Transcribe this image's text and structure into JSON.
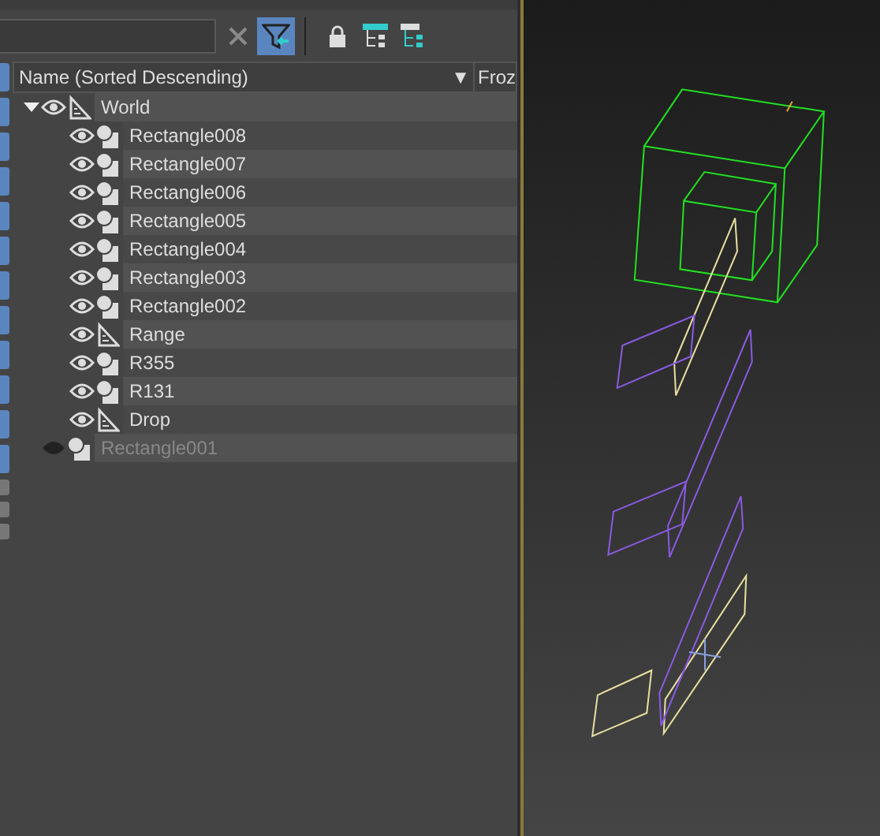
{
  "columns": [
    {
      "label": "Name (Sorted Descending)",
      "sort_icon": "▼"
    },
    {
      "label": "Froz"
    }
  ],
  "tree": [
    {
      "name": "World",
      "kind": "helper",
      "visible": true,
      "expanded": true,
      "children": [
        {
          "name": "Rectangle008",
          "kind": "shape",
          "visible": true
        },
        {
          "name": "Rectangle007",
          "kind": "shape",
          "visible": true
        },
        {
          "name": "Rectangle006",
          "kind": "shape",
          "visible": true
        },
        {
          "name": "Rectangle005",
          "kind": "shape",
          "visible": true
        },
        {
          "name": "Rectangle004",
          "kind": "shape",
          "visible": true
        },
        {
          "name": "Rectangle003",
          "kind": "shape",
          "visible": true
        },
        {
          "name": "Rectangle002",
          "kind": "shape",
          "visible": true
        },
        {
          "name": "Range",
          "kind": "helper",
          "visible": true
        },
        {
          "name": "R355",
          "kind": "shape",
          "visible": true
        },
        {
          "name": "R131",
          "kind": "shape",
          "visible": true
        },
        {
          "name": "Drop",
          "kind": "helper",
          "visible": true
        }
      ]
    },
    {
      "name": "Rectangle001",
      "kind": "shape",
      "visible": false
    }
  ],
  "filter": {
    "on": true
  }
}
